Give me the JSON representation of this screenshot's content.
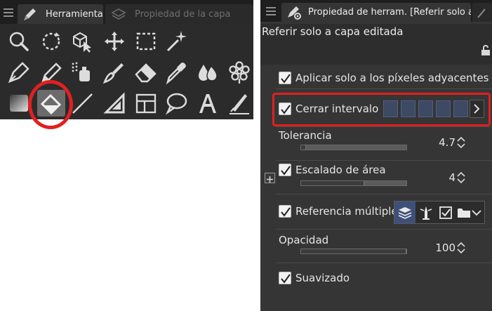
{
  "left_panel": {
    "tab_tool": "Herramienta",
    "tab_subtool_props": "Propiedad de la capa",
    "tools": [
      {
        "name": "zoom-tool"
      },
      {
        "name": "rotate-tool"
      },
      {
        "name": "operation-tool"
      },
      {
        "name": "move-tool"
      },
      {
        "name": "selection-tool"
      },
      {
        "name": "auto-select-tool"
      },
      {
        "name": "pen-tool"
      },
      {
        "name": "pencil-tool"
      },
      {
        "name": "airbrush-tool"
      },
      {
        "name": "brush-tool"
      },
      {
        "name": "eraser-tool"
      },
      {
        "name": "eyedropper-tool"
      },
      {
        "name": "blend-tool"
      },
      {
        "name": "decoration-tool"
      },
      {
        "name": "gradient-tool"
      },
      {
        "name": "fill-tool",
        "selected": true
      },
      {
        "name": "line-tool"
      },
      {
        "name": "ruler-tool"
      },
      {
        "name": "frame-tool"
      },
      {
        "name": "balloon-tool"
      },
      {
        "name": "text-tool"
      },
      {
        "name": "correct-line-tool"
      }
    ]
  },
  "right_panel": {
    "tab_title": "Propiedad de herram. [Referir solo a",
    "layer_ref_title": "Referir solo a capa editada",
    "props": {
      "adjacent": {
        "label": "Aplicar solo a los píxeles adyacentes",
        "checked": true
      },
      "close_gap": {
        "label": "Cerrar intervalo",
        "checked": true,
        "level": 5,
        "levels": 5
      },
      "tolerance": {
        "label": "Tolerancia",
        "value": "4.7",
        "fill": 0.047
      },
      "area_scaling": {
        "label": "Escalado de área",
        "checked": true,
        "value": "4",
        "fill": 0.6
      },
      "multi_ref": {
        "label": "Referencia múltiple",
        "checked": true
      },
      "opacity": {
        "label": "Opacidad",
        "value": "100",
        "fill": 1.0
      },
      "antialias": {
        "label": "Suavizado",
        "checked": true
      }
    }
  },
  "colors": {
    "highlight": "#e02020",
    "accent_blue": "#3e4f7a"
  }
}
